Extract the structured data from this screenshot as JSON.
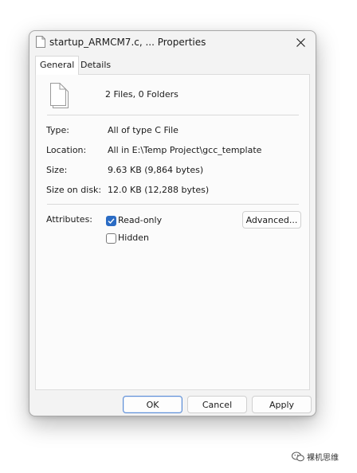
{
  "window": {
    "title": "startup_ARMCM7.c, ... Properties"
  },
  "tabs": [
    {
      "label": "General",
      "active": true
    },
    {
      "label": "Details",
      "active": false
    }
  ],
  "summary": "2 Files, 0 Folders",
  "props": {
    "type_label": "Type:",
    "type_value": "All of type C File",
    "location_label": "Location:",
    "location_value": "All in E:\\Temp Project\\gcc_template",
    "size_label": "Size:",
    "size_value": "9.63 KB (9,864 bytes)",
    "disk_label": "Size on disk:",
    "disk_value": "12.0 KB (12,288 bytes)"
  },
  "attributes": {
    "label": "Attributes:",
    "readonly_label": "Read-only",
    "readonly_checked": true,
    "hidden_label": "Hidden",
    "hidden_checked": false,
    "advanced_label": "Advanced..."
  },
  "buttons": {
    "ok": "OK",
    "cancel": "Cancel",
    "apply": "Apply"
  },
  "watermark": "裸机思维",
  "colors": {
    "accent": "#2b6cc4",
    "window_bg": "#f3f3f3",
    "panel_bg": "#fbfbfb"
  }
}
